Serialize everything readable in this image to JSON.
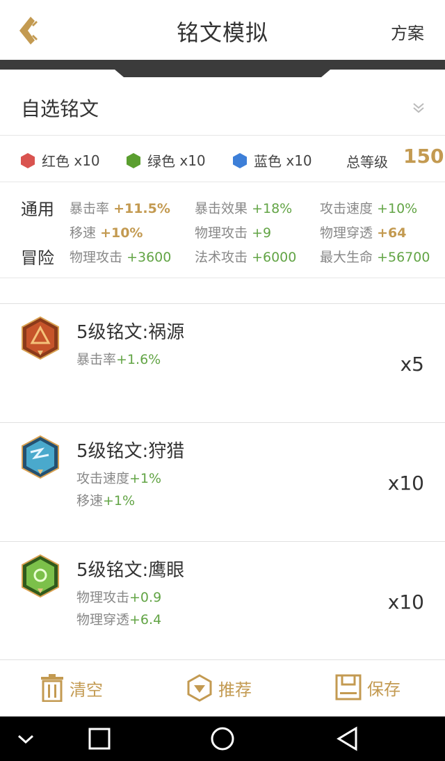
{
  "header": {
    "title": "铭文模拟",
    "plan_label": "方案"
  },
  "selector": {
    "label": "自选铭文"
  },
  "colors": [
    {
      "name": "红色",
      "count": "x10",
      "color": "#d9534f"
    },
    {
      "name": "绿色",
      "count": "x10",
      "color": "#5a9e2f"
    },
    {
      "name": "蓝色",
      "count": "x10",
      "color": "#3d7fd8"
    }
  ],
  "total": {
    "label": "总等级",
    "value": "150"
  },
  "stats": {
    "general_label": "通用",
    "adventure_label": "冒险",
    "general": [
      {
        "name": "暴击率",
        "value": "+11.5%"
      },
      {
        "name": "暴击效果",
        "value": "+18%"
      },
      {
        "name": "攻击速度",
        "value": "+10%"
      },
      {
        "name": "移速",
        "value": "+10%"
      },
      {
        "name": "物理攻击",
        "value": "+9"
      },
      {
        "name": "物理穿透",
        "value": "+64"
      }
    ],
    "adventure": [
      {
        "name": "物理攻击",
        "value": "+3600"
      },
      {
        "name": "法术攻击",
        "value": "+6000"
      },
      {
        "name": "最大生命",
        "value": "+56700"
      }
    ]
  },
  "runes": [
    {
      "name": "5级铭文:祸源",
      "count": "x5",
      "icon": "red-rune-icon",
      "attrs": [
        {
          "name": "暴击率",
          "value": "+1.6%"
        }
      ]
    },
    {
      "name": "5级铭文:狩猎",
      "count": "x10",
      "icon": "blue-rune-icon",
      "attrs": [
        {
          "name": "攻击速度",
          "value": "+1%"
        },
        {
          "name": "移速",
          "value": "+1%"
        }
      ]
    },
    {
      "name": "5级铭文:鹰眼",
      "count": "x10",
      "icon": "green-rune-icon",
      "attrs": [
        {
          "name": "物理攻击",
          "value": "+0.9"
        },
        {
          "name": "物理穿透",
          "value": "+6.4"
        }
      ]
    }
  ],
  "actions": {
    "clear": "清空",
    "recommend": "推荐",
    "save": "保存"
  },
  "accent": "#c39a51",
  "positive": "#62a445"
}
